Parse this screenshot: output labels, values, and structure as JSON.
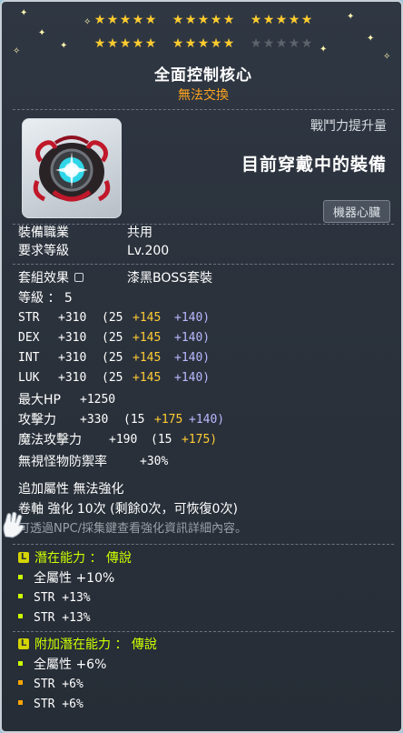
{
  "stars": {
    "row1_filled": 15,
    "row1_total": 15,
    "row2_filled": 10,
    "row2_total": 15
  },
  "item": {
    "name": "全面控制核心",
    "trade": "無法交換",
    "power_label": "戰鬥力提升量",
    "equipped_label": "目前穿戴中的裝備",
    "slot_button": "機器心臟",
    "icon": "mechanical-heart-icon"
  },
  "requirements": {
    "job_label": "裝備職業",
    "job_value": "共用",
    "level_label": "要求等級",
    "level_value": "Lv.200"
  },
  "set_effect": {
    "label": "套組效果",
    "value": "漆黑BOSS套裝"
  },
  "grade": "等級 ： 5",
  "stats": [
    {
      "name": "STR",
      "base": "+310",
      "open": "(25",
      "star": "+145",
      "bonus": "+140)"
    },
    {
      "name": "DEX",
      "base": "+310",
      "open": "(25",
      "star": "+145",
      "bonus": "+140)"
    },
    {
      "name": "INT",
      "base": "+310",
      "open": "(25",
      "star": "+145",
      "bonus": "+140)"
    },
    {
      "name": "LUK",
      "base": "+310",
      "open": "(25",
      "star": "+145",
      "bonus": "+140)"
    }
  ],
  "max_hp": {
    "name": "最大HP",
    "value": "+1250"
  },
  "attack": {
    "name": "攻擊力",
    "base": "+330",
    "open": "(15",
    "star": "+175",
    "bonus": "+140)"
  },
  "magic_attack": {
    "name": "魔法攻擊力",
    "base": "+190",
    "open": "(15",
    "star": "+175)"
  },
  "ignore_def": {
    "name": "無視怪物防禦率",
    "value": "+30%"
  },
  "flame": "追加屬性 無法強化",
  "scroll": "卷軸 強化 10次 (剩餘0次，可恢復0次)",
  "hint": "可透過NPC/採集鍵查看強化資訊詳細內容。",
  "potential": {
    "title": "潛在能力 ： 傳說",
    "badge": "L",
    "lines": [
      "全屬性 +10%",
      "STR +13%",
      "STR +13%"
    ],
    "color": "#ccff00"
  },
  "bonus_potential": {
    "title": "附加潛在能力 ： 傳說",
    "badge": "L",
    "lines": [
      "全屬性 +6%",
      "STR +6%",
      "STR +6%"
    ],
    "color": "#ffa500"
  },
  "colors": {
    "background": "#2b323c",
    "star_gold": "#ffcc2e",
    "trade_orange": "#ffa51f",
    "star_bonus": "#ffcc33",
    "flame_bonus": "#b9b9ff"
  }
}
